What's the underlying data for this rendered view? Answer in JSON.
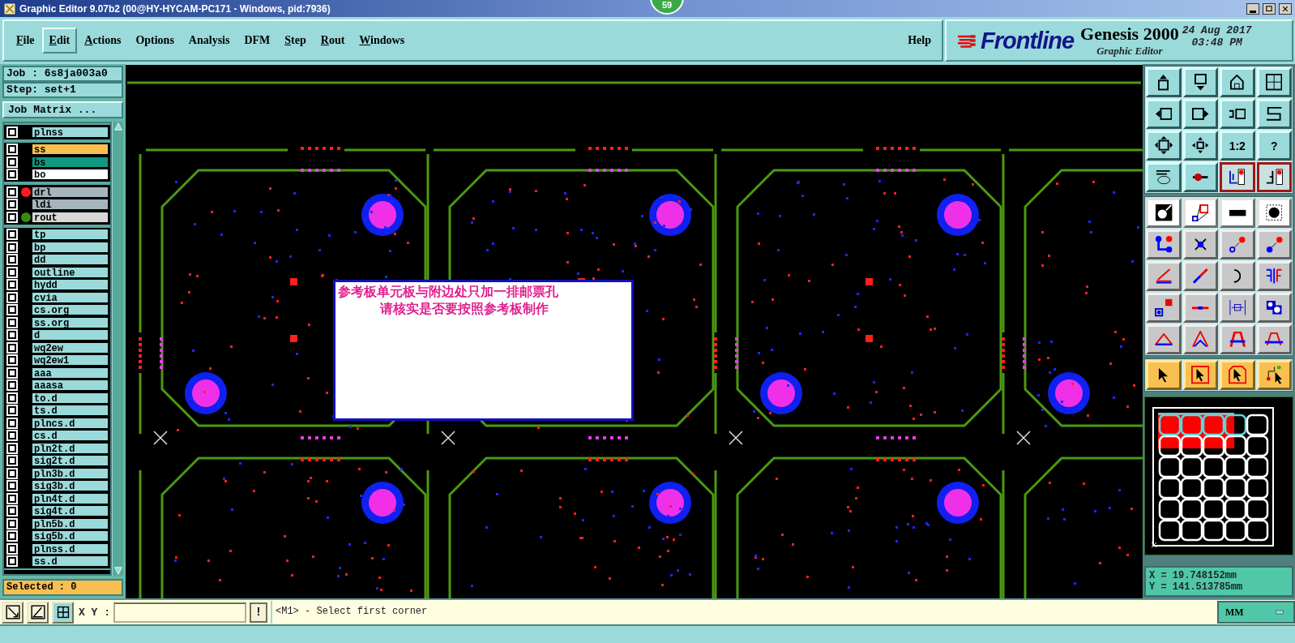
{
  "window": {
    "title": "Graphic Editor 9.07b2 (00@HY-HYCAM-PC171 - Windows, pid:7936)",
    "notification_badge": "59"
  },
  "menu": [
    {
      "label": "File",
      "mnemonic": true,
      "raised": false
    },
    {
      "label": "Edit",
      "mnemonic": true,
      "raised": true
    },
    {
      "label": "Actions",
      "mnemonic": true,
      "raised": false
    },
    {
      "label": "Options",
      "mnemonic": false,
      "raised": false
    },
    {
      "label": "Analysis",
      "mnemonic": false,
      "raised": false
    },
    {
      "label": "DFM",
      "mnemonic": false,
      "raised": false
    },
    {
      "label": "Step",
      "mnemonic": true,
      "raised": false
    },
    {
      "label": "Rout",
      "mnemonic": true,
      "raised": false
    },
    {
      "label": "Windows",
      "mnemonic": true,
      "raised": false
    }
  ],
  "help": "Help",
  "brand": {
    "logo": "Frontline",
    "product": "Genesis 2000",
    "subtitle": "Graphic Editor",
    "date": "24 Aug 2017",
    "time": "03:48 PM"
  },
  "job": "Job : 6s8ja003a0",
  "step": "Step: set+1",
  "job_matrix_button": "Job Matrix ...",
  "layer_groups": [
    {
      "layers": [
        {
          "name": "plnss",
          "checked": false,
          "kind": "plain"
        }
      ]
    },
    {
      "layers": [
        {
          "name": "ss",
          "checked": false,
          "kind": "silk"
        },
        {
          "name": "bs",
          "checked": false,
          "kind": "solder"
        },
        {
          "name": "bo",
          "checked": false,
          "kind": "outline"
        }
      ]
    },
    {
      "layers": [
        {
          "name": "drl",
          "checked": false,
          "kind": "drill",
          "color": "#ff1a1a"
        },
        {
          "name": "ldi",
          "checked": false,
          "kind": "drill"
        },
        {
          "name": "rout",
          "checked": false,
          "kind": "rout",
          "color": "#3a8a10"
        }
      ]
    },
    {
      "layers": [
        {
          "name": "tp",
          "checked": false,
          "kind": "plain"
        },
        {
          "name": "bp",
          "checked": false,
          "kind": "plain"
        },
        {
          "name": "dd",
          "checked": false,
          "kind": "plain"
        },
        {
          "name": "outline",
          "checked": false,
          "kind": "plain"
        },
        {
          "name": "hydd",
          "checked": false,
          "kind": "plain"
        },
        {
          "name": "cvia",
          "checked": false,
          "kind": "plain"
        },
        {
          "name": "cs.org",
          "checked": false,
          "kind": "plain"
        },
        {
          "name": "ss.org",
          "checked": false,
          "kind": "plain"
        },
        {
          "name": "d",
          "checked": false,
          "kind": "plain"
        },
        {
          "name": "wq2ew",
          "checked": false,
          "kind": "plain"
        },
        {
          "name": "wq2ew1",
          "checked": false,
          "kind": "plain"
        },
        {
          "name": "aaa",
          "checked": false,
          "kind": "plain"
        },
        {
          "name": "aaasa",
          "checked": false,
          "kind": "plain"
        },
        {
          "name": "to.d",
          "checked": false,
          "kind": "plain"
        },
        {
          "name": "ts.d",
          "checked": false,
          "kind": "plain"
        },
        {
          "name": "plncs.d",
          "checked": false,
          "kind": "plain"
        },
        {
          "name": "cs.d",
          "checked": false,
          "kind": "plain"
        },
        {
          "name": "pln2t.d",
          "checked": false,
          "kind": "plain"
        },
        {
          "name": "sig2t.d",
          "checked": false,
          "kind": "plain"
        },
        {
          "name": "pln3b.d",
          "checked": false,
          "kind": "plain"
        },
        {
          "name": "sig3b.d",
          "checked": false,
          "kind": "plain"
        },
        {
          "name": "pln4t.d",
          "checked": false,
          "kind": "plain"
        },
        {
          "name": "sig4t.d",
          "checked": false,
          "kind": "plain"
        },
        {
          "name": "pln5b.d",
          "checked": false,
          "kind": "plain"
        },
        {
          "name": "sig5b.d",
          "checked": false,
          "kind": "plain"
        },
        {
          "name": "plnss.d",
          "checked": false,
          "kind": "plain"
        },
        {
          "name": "ss.d",
          "checked": false,
          "kind": "plain"
        }
      ]
    }
  ],
  "selected_count": "Selected : 0",
  "note": {
    "lines": [
      "参考板单元板与附边处只加一排邮票孔",
      "请核实是否要按照参考板制作"
    ]
  },
  "tool_rows": [
    {
      "kind": "view",
      "buttons": [
        {
          "on": false
        },
        {
          "on": false
        },
        {
          "on": false
        },
        {
          "on": false
        }
      ]
    },
    {
      "kind": "view",
      "buttons": [
        {
          "on": false
        },
        {
          "on": false
        },
        {
          "on": false
        },
        {
          "on": false
        }
      ]
    },
    {
      "kind": "view",
      "buttons": [
        {
          "on": false
        },
        {
          "on": false
        },
        {
          "on": false,
          "label": "1:2"
        },
        {
          "on": false,
          "label": "?"
        }
      ]
    },
    {
      "kind": "view",
      "buttons": [
        {
          "on": false
        },
        {
          "on": false
        },
        {
          "on": true
        },
        {
          "on": true
        }
      ]
    },
    {
      "kind": "measure",
      "buttons": [
        {
          "on": false
        },
        {
          "on": false
        },
        {
          "on": false
        },
        {
          "on": false
        }
      ]
    },
    {
      "kind": "edit",
      "buttons": [
        {
          "on": false
        },
        {
          "on": false
        },
        {
          "on": false
        },
        {
          "on": false
        }
      ]
    },
    {
      "kind": "edit",
      "buttons": [
        {
          "on": false
        },
        {
          "on": false
        },
        {
          "on": false
        },
        {
          "on": false
        }
      ]
    },
    {
      "kind": "edit",
      "buttons": [
        {
          "on": false
        },
        {
          "on": false
        },
        {
          "on": false
        },
        {
          "on": false
        }
      ]
    },
    {
      "kind": "edit",
      "buttons": [
        {
          "on": false
        },
        {
          "on": false
        },
        {
          "on": false
        },
        {
          "on": false
        }
      ]
    },
    {
      "kind": "select",
      "buttons": [
        {
          "on": false
        },
        {
          "on": false
        },
        {
          "on": false
        },
        {
          "on": false
        }
      ]
    }
  ],
  "coordinates": {
    "x": "X = 19.748152mm",
    "y": "Y = 141.513785mm"
  },
  "bottom": {
    "xy_label": "X Y :",
    "bang_button": "!",
    "status": "<M1> - Select first corner",
    "units": "MM"
  }
}
